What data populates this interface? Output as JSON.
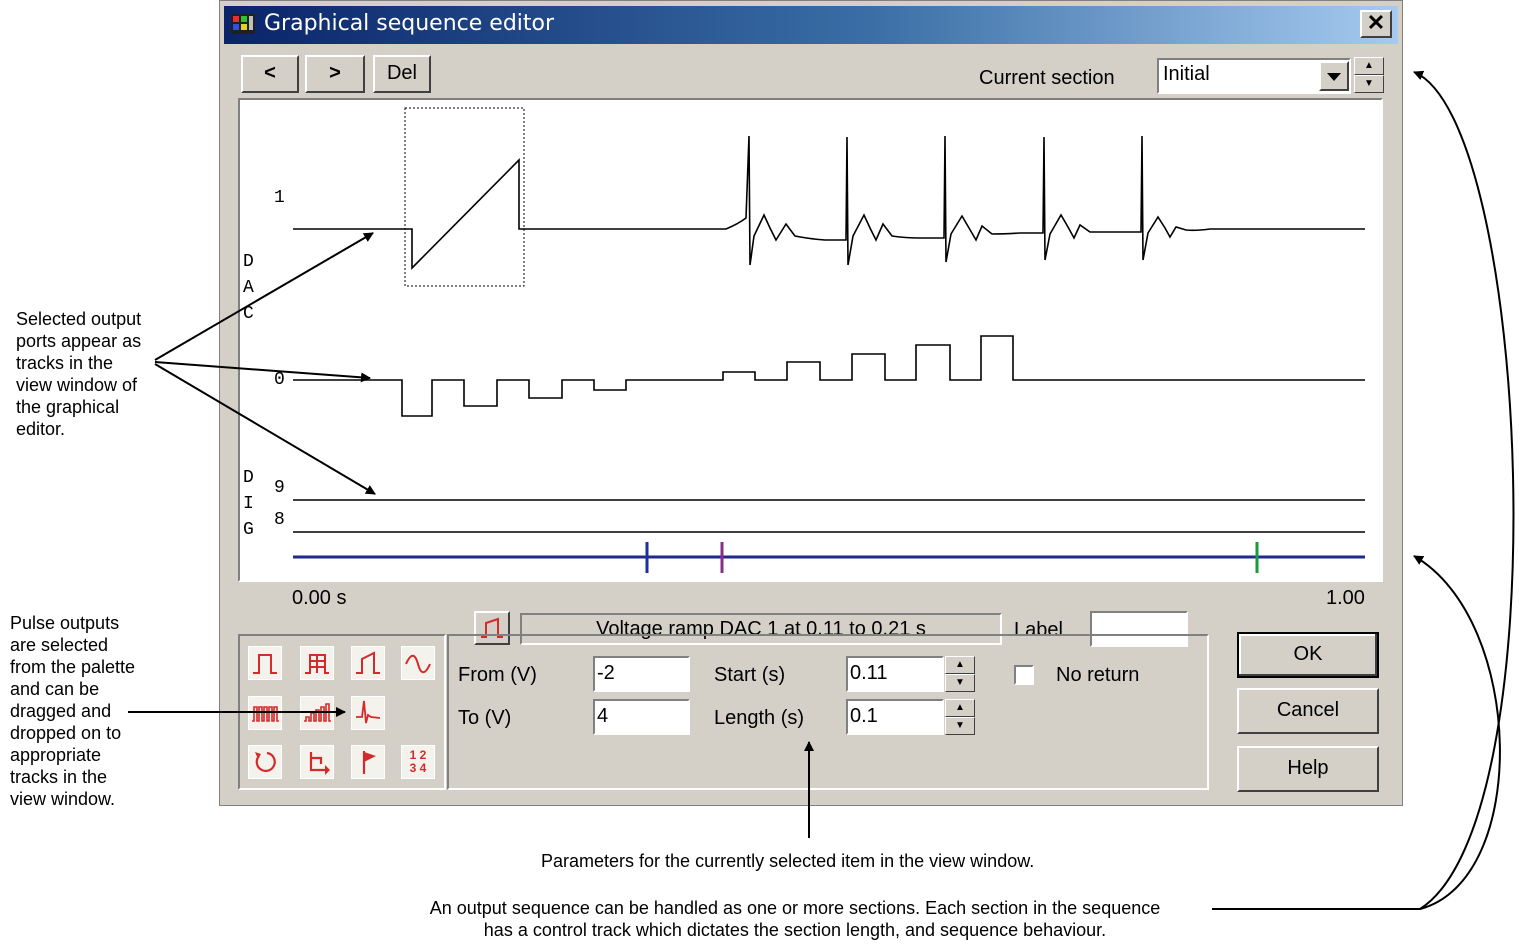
{
  "window": {
    "title": "Graphical sequence editor",
    "close_label": "✕"
  },
  "toolbar": {
    "prev_label": "<",
    "next_label": ">",
    "del_label": "Del",
    "current_section_label": "Current section",
    "current_section_value": "Initial"
  },
  "view": {
    "dac_label": [
      "D",
      "A",
      "C"
    ],
    "dig_label": [
      "D",
      "I",
      "G"
    ],
    "track_dac1": "1",
    "track_dac0": "0",
    "track_dig9": "9",
    "track_dig8": "8",
    "time_start": "0.00 s",
    "time_end": "1.00",
    "control_marker_colors": [
      "#1f2f9f",
      "#8a2c8a",
      "#1a9a3a"
    ],
    "control_track_color": "#1f2a8c"
  },
  "item_bar": {
    "description": "Voltage ramp DAC 1 at 0.11 to 0.21 s",
    "label_caption": "Label",
    "label_value": ""
  },
  "params": {
    "from_label": "From (V)",
    "from_value": "-2",
    "to_label": "To (V)",
    "to_value": "4",
    "start_label": "Start (s)",
    "start_value": "0.11",
    "length_label": "Length (s)",
    "length_value": "0.1",
    "no_return_label": "No return"
  },
  "buttons": {
    "ok": "OK",
    "cancel": "Cancel",
    "help": "Help"
  },
  "palette": {
    "icons": [
      "pulse-icon",
      "multi-step-pulse-icon",
      "ramp-icon",
      "sine-icon",
      "pulse-train-icon",
      "stepped-train-icon",
      "waveform-icon",
      "loop-icon",
      "jump-icon",
      "flag-icon",
      "count-icon"
    ],
    "count_glyph": "1 2\n3 4",
    "accent": "#d42a2a"
  },
  "notes": {
    "tracks": [
      "Selected output",
      "ports appear as",
      "tracks in the",
      "view window of",
      "the graphical",
      "editor."
    ],
    "palette": [
      "Pulse outputs",
      "are selected",
      "from the palette",
      "and can be",
      "dragged and",
      "dropped on to",
      "appropriate",
      "tracks in the",
      "view window."
    ],
    "parameters": "Parameters for the currently selected item in the view window.",
    "sections": [
      "An output sequence can be handled as one or more sections. Each section in the sequence",
      "has a control track which dictates the section length, and sequence behaviour."
    ]
  }
}
